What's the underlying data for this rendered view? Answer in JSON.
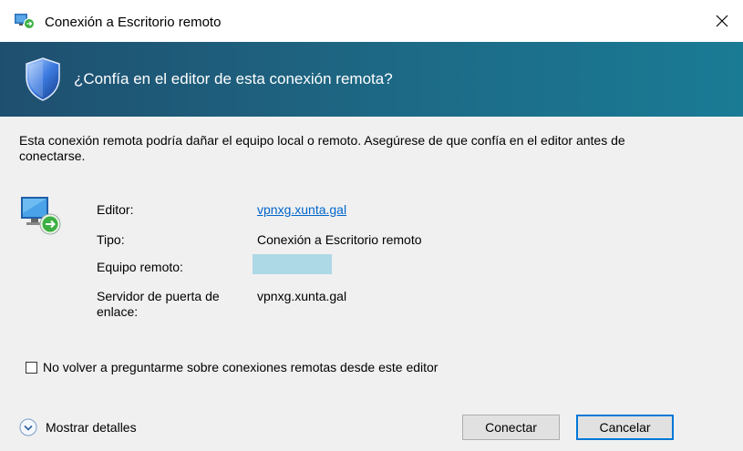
{
  "window": {
    "title": "Conexión a Escritorio remoto",
    "close_label": "✕"
  },
  "banner": {
    "title": "¿Confía en el editor de esta conexión remota?",
    "icon": "shield-icon"
  },
  "description": "Esta conexión remota podría dañar el equipo local o remoto. Asegúrese de que confía en el editor antes de conectarse.",
  "details": {
    "icon": "remote-desktop-icon",
    "rows": [
      {
        "label": "Editor:",
        "value": "vpnxg.xunta.gal"
      },
      {
        "label": "Tipo:",
        "value": "Conexión a Escritorio remoto"
      },
      {
        "label": "Equipo remoto:",
        "value": ""
      },
      {
        "label": "Servidor de puerta de enlace:",
        "value": "vpnxg.xunta.gal"
      }
    ]
  },
  "checkbox": {
    "label": "No volver a preguntarme sobre conexiones remotas desde este editor",
    "checked": false
  },
  "footer": {
    "show_details_label": "Mostrar detalles",
    "connect_label": "Conectar",
    "cancel_label": "Cancelar"
  },
  "colors": {
    "banner_start": "#1f4f6f",
    "banner_end": "#1a7b95",
    "link": "#0066cc",
    "focus": "#0078d7",
    "masked_field": "#add8e6"
  }
}
